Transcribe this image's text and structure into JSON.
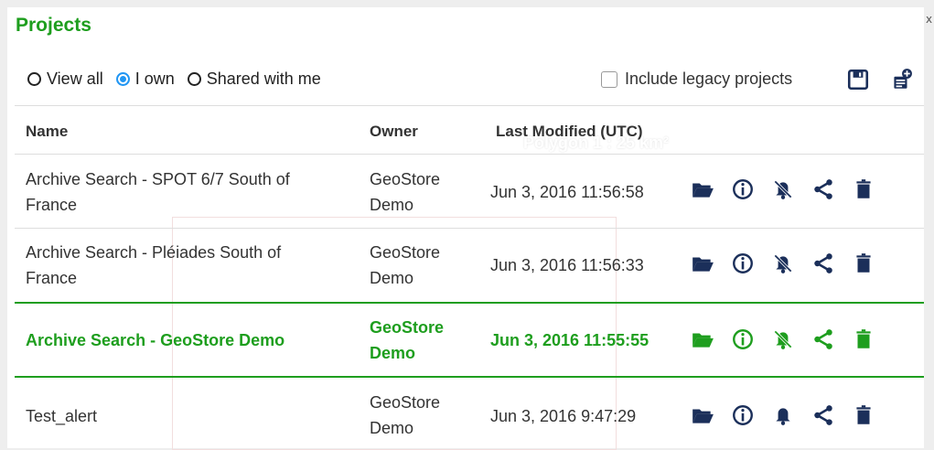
{
  "panel": {
    "title": "Projects",
    "close_glyph": "x"
  },
  "filters": {
    "options": [
      {
        "label": "View all",
        "selected": false
      },
      {
        "label": "I own",
        "selected": true
      },
      {
        "label": "Shared with me",
        "selected": false
      }
    ],
    "legacy_label": "Include legacy projects",
    "legacy_checked": false
  },
  "toolbar": {
    "save_icon": "save-icon",
    "new_project_icon": "new-project-icon"
  },
  "table": {
    "columns": [
      "Name",
      "Owner",
      "Last Modified (UTC)"
    ],
    "rows": [
      {
        "name_line1": "Archive Search - SPOT 6/7 South of",
        "name_line2": "France",
        "owner_line1": "GeoStore",
        "owner_line2": "Demo",
        "modified": "Jun 3, 2016 11:56:58",
        "alert": "bell-off-icon"
      },
      {
        "name_line1": "Archive Search - Pléiades South of",
        "name_line2": "France",
        "owner_line1": "GeoStore",
        "owner_line2": "Demo",
        "modified": "Jun 3, 2016 11:56:33",
        "alert": "bell-off-icon"
      },
      {
        "name_line1": "Archive Search - GeoStore Demo",
        "name_line2": "",
        "owner_line1": "GeoStore",
        "owner_line2": "Demo",
        "modified": "Jun 3, 2016 11:55:55",
        "alert": "bell-off-icon",
        "selected": true
      },
      {
        "name_line1": "Test_alert",
        "name_line2": "",
        "owner_line1": "GeoStore",
        "owner_line2": "Demo",
        "modified": "Jun 3, 2016 9:47:29",
        "alert": "bell-icon"
      }
    ]
  },
  "background_map_label": "Polygon 1 : 25 km²",
  "colors": {
    "accent_green": "#1e9e1e",
    "icon_navy": "#1b2f5a",
    "radio_blue": "#2196f3"
  }
}
